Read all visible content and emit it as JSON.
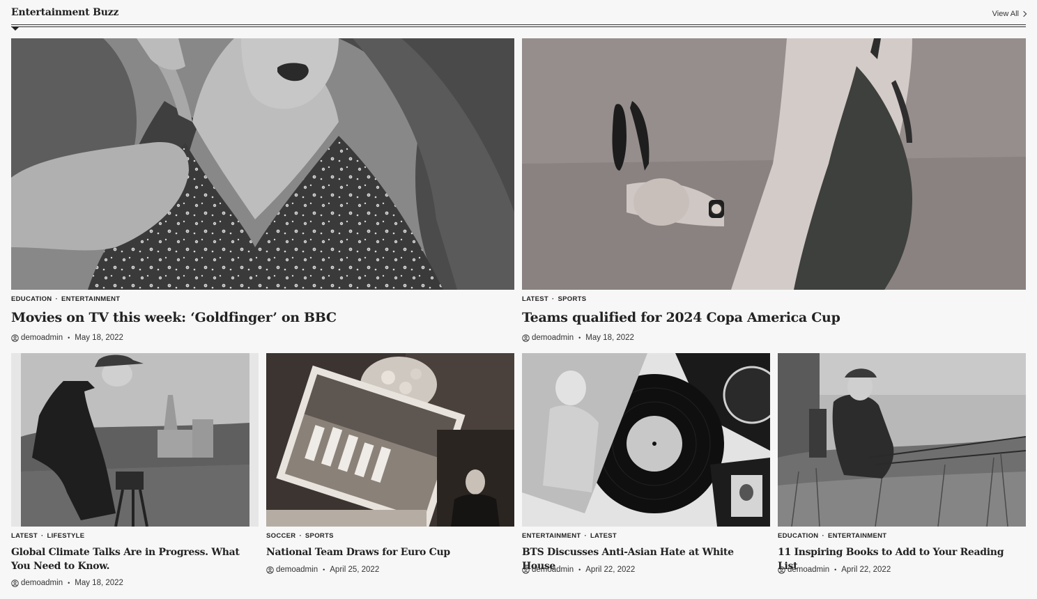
{
  "section": {
    "title": "Entertainment Buzz",
    "view_all": "View All"
  },
  "featured": [
    {
      "categories": [
        "EDUCATION",
        "ENTERTAINMENT"
      ],
      "title": "Movies on TV this week: ‘Goldfinger’ on BBC",
      "author": "demoadmin",
      "date": "May 18, 2022",
      "image": "woman-in-floral-dress-photo"
    },
    {
      "categories": [
        "LATEST",
        "SPORTS"
      ],
      "title": "Teams qualified for 2024 Copa America Cup",
      "author": "demoadmin",
      "date": "May 18, 2022",
      "image": "woman-holding-sunglasses-photo"
    }
  ],
  "grid": [
    {
      "categories": [
        "LATEST",
        "LIFESTYLE"
      ],
      "title": "Global Climate Talks Are in Progress. What You Need to Know.",
      "author": "demoadmin",
      "date": "May 18, 2022",
      "image": "man-with-camera-photo"
    },
    {
      "categories": [
        "SOCCER",
        "SPORTS"
      ],
      "title": "National Team Draws for Euro Cup",
      "author": "demoadmin",
      "date": "April 25, 2022",
      "image": "vintage-photographs-collage"
    },
    {
      "categories": [
        "ENTERTAINMENT",
        "LATEST"
      ],
      "title": "BTS Discusses Anti-Asian Hate at White House",
      "author": "demoadmin",
      "date": "April 22, 2022",
      "image": "vinyl-record-photo"
    },
    {
      "categories": [
        "EDUCATION",
        "ENTERTAINMENT"
      ],
      "title": "11 Inspiring Books to Add to Your Reading List",
      "author": "demoadmin",
      "date": "April 22, 2022",
      "image": "man-fishing-photo"
    }
  ]
}
